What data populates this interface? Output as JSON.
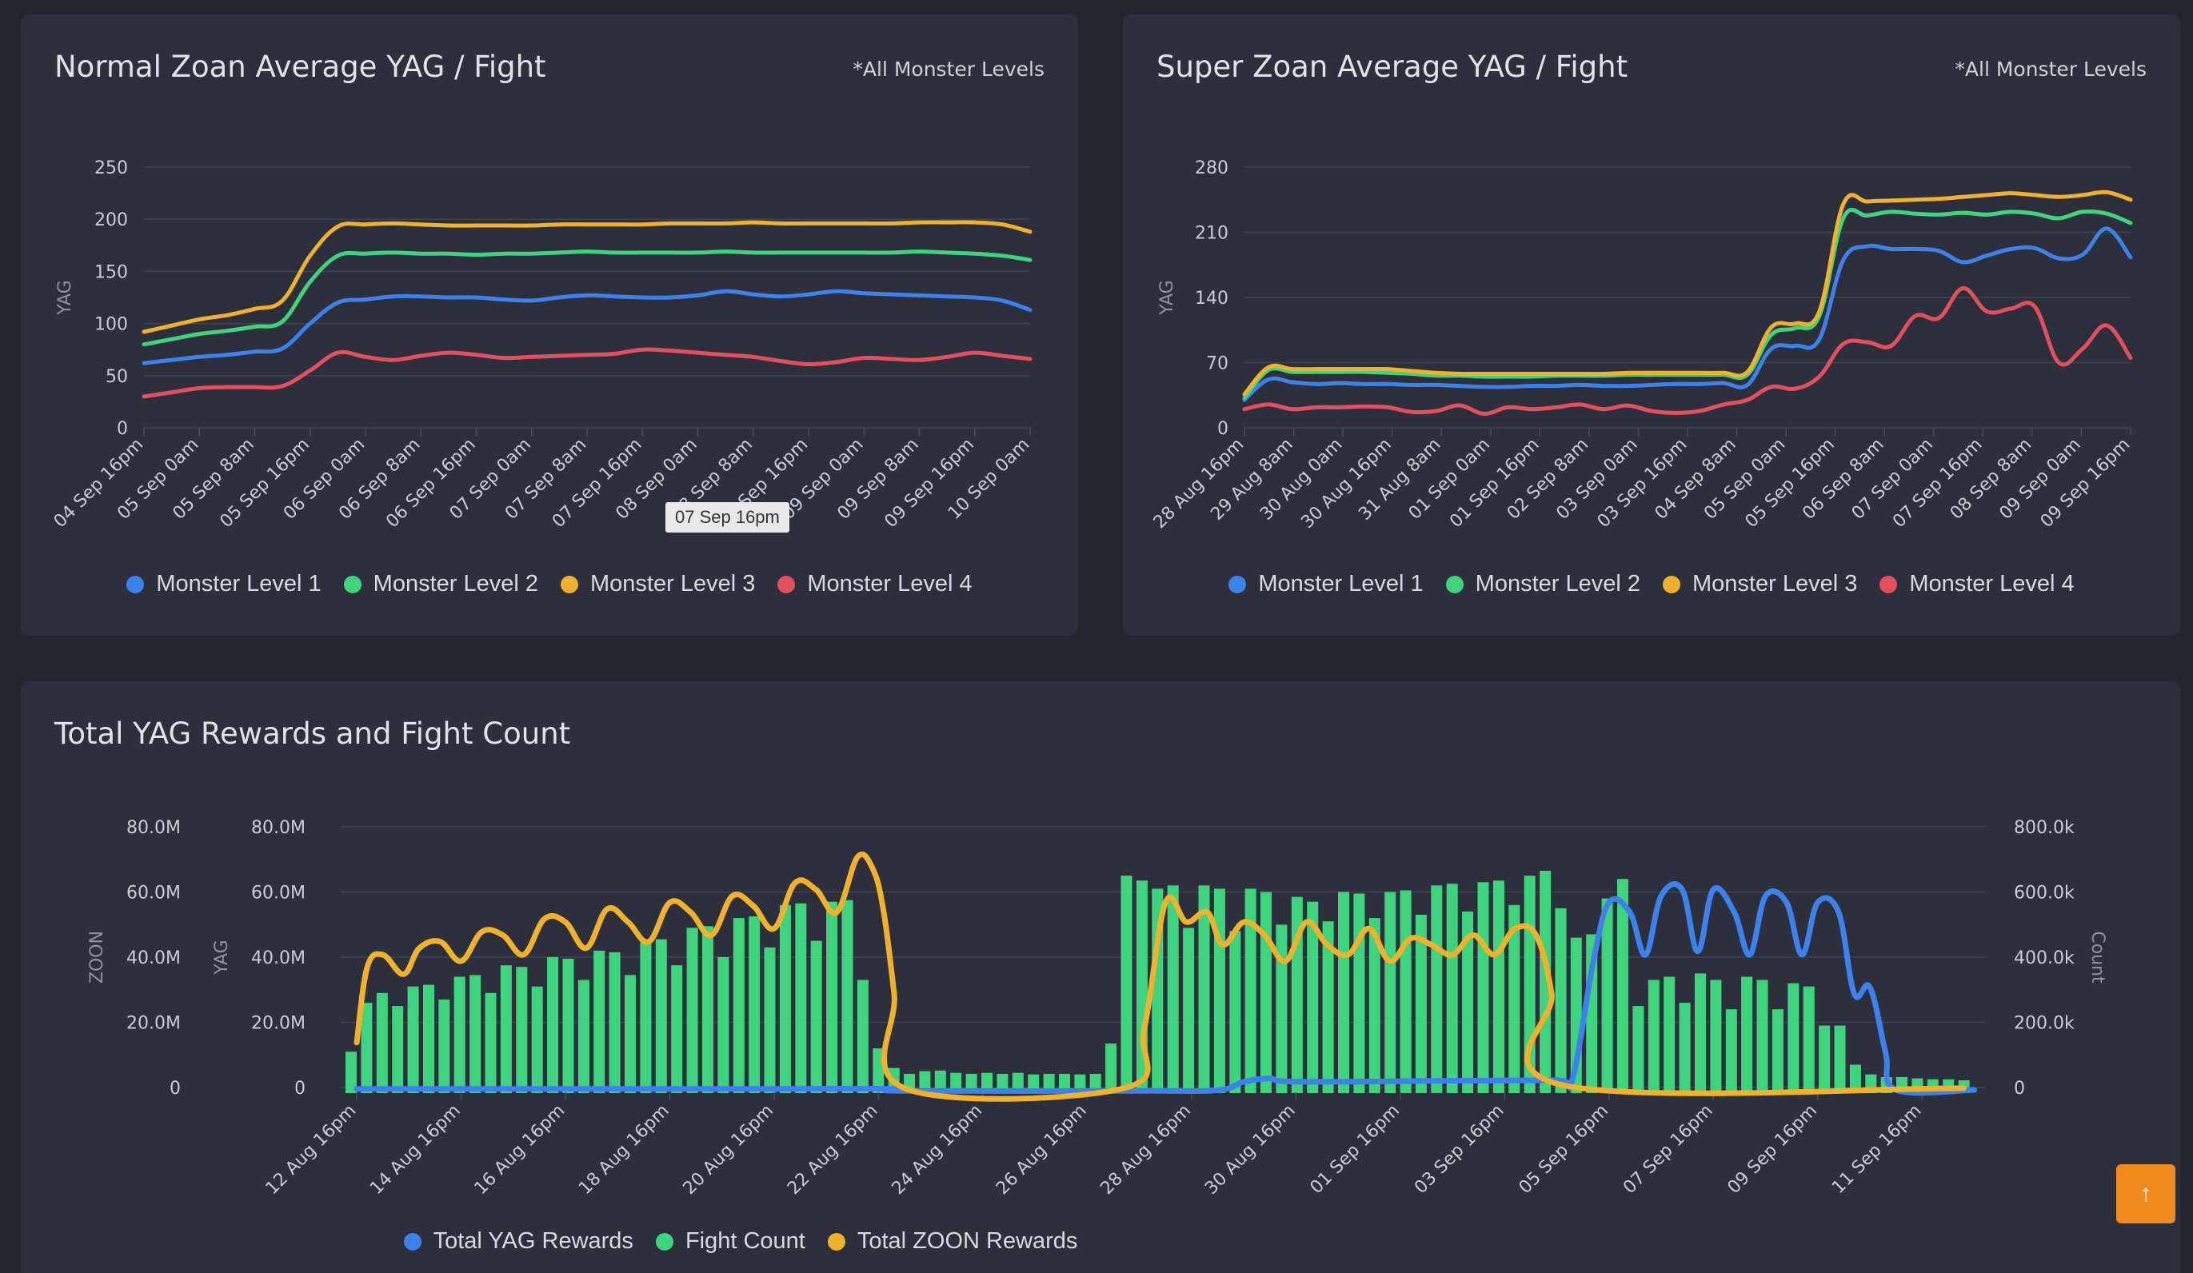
{
  "normal_card": {
    "title": "Normal Zoan Average YAG / Fight",
    "note": "*All Monster Levels",
    "tooltip": "07 Sep 16pm"
  },
  "super_card": {
    "title": "Super Zoan Average YAG / Fight",
    "note": "*All Monster Levels"
  },
  "total_card": {
    "title": "Total YAG Rewards and Fight Count"
  },
  "scroll_top": {
    "icon": "arrow-up-icon",
    "glyph": "↑"
  },
  "chart_data": [
    {
      "id": "normal",
      "type": "line",
      "ylabel": "YAG",
      "ylim": [
        0,
        250
      ],
      "yticks": [
        0,
        50,
        100,
        150,
        200,
        250
      ],
      "xticks": [
        "04 Sep 16pm",
        "05 Sep 0am",
        "05 Sep 8am",
        "05 Sep 16pm",
        "06 Sep 0am",
        "06 Sep 8am",
        "06 Sep 16pm",
        "07 Sep 0am",
        "07 Sep 8am",
        "07 Sep 16pm",
        "08 Sep 0am",
        "08 Sep 8am",
        "08 Sep 16pm",
        "09 Sep 0am",
        "09 Sep 8am",
        "09 Sep 16pm",
        "10 Sep 0am"
      ],
      "x": [
        0,
        0.5,
        1,
        1.5,
        2,
        2.5,
        3,
        3.5,
        4,
        4.5,
        5,
        5.5,
        6,
        6.5,
        7,
        7.5,
        8,
        8.5,
        9,
        9.5,
        10,
        10.5,
        11,
        11.5,
        12,
        12.5,
        13,
        13.5,
        14,
        14.5,
        15,
        15.5,
        16
      ],
      "grid": true,
      "legend_position": "bottom",
      "series": [
        {
          "name": "Monster Level 1",
          "color": "#3d82ec",
          "values": [
            62,
            65,
            68,
            70,
            73,
            76,
            100,
            120,
            123,
            126,
            126,
            125,
            125,
            123,
            122,
            125,
            127,
            126,
            125,
            125,
            127,
            131,
            128,
            126,
            128,
            131,
            129,
            128,
            127,
            126,
            125,
            122,
            113
          ]
        },
        {
          "name": "Monster Level 2",
          "color": "#3ed47e",
          "values": [
            80,
            85,
            90,
            93,
            97,
            102,
            140,
            165,
            167,
            168,
            167,
            167,
            166,
            167,
            167,
            168,
            169,
            168,
            168,
            168,
            168,
            169,
            168,
            168,
            168,
            168,
            168,
            168,
            169,
            168,
            167,
            165,
            161
          ]
        },
        {
          "name": "Monster Level 3",
          "color": "#f0b22b",
          "values": [
            92,
            98,
            104,
            108,
            114,
            122,
            165,
            193,
            195,
            196,
            195,
            194,
            194,
            194,
            194,
            195,
            195,
            195,
            195,
            196,
            196,
            196,
            197,
            196,
            196,
            196,
            196,
            196,
            197,
            197,
            197,
            195,
            188
          ]
        },
        {
          "name": "Monster Level 4",
          "color": "#e34f5f",
          "values": [
            30,
            34,
            38,
            39,
            39,
            40,
            55,
            72,
            68,
            65,
            69,
            72,
            70,
            67,
            68,
            69,
            70,
            71,
            75,
            74,
            72,
            70,
            68,
            64,
            61,
            63,
            67,
            66,
            65,
            68,
            72,
            69,
            66
          ]
        }
      ]
    },
    {
      "id": "super",
      "type": "line",
      "ylabel": "YAG",
      "ylim": [
        0,
        280
      ],
      "yticks": [
        0,
        70,
        140,
        210,
        280
      ],
      "xticks": [
        "28 Aug 16pm",
        "29 Aug 8am",
        "30 Aug 0am",
        "30 Aug 16pm",
        "31 Aug 8am",
        "01 Sep 0am",
        "01 Sep 16pm",
        "02 Sep 8am",
        "03 Sep 0am",
        "03 Sep 16pm",
        "04 Sep 8am",
        "05 Sep 0am",
        "05 Sep 16pm",
        "06 Sep 8am",
        "07 Sep 0am",
        "07 Sep 16pm",
        "08 Sep 8am",
        "09 Sep 0am",
        "09 Sep 16pm"
      ],
      "x": [
        0,
        0.5,
        1,
        1.5,
        2,
        2.5,
        3,
        3.5,
        4,
        4.5,
        5,
        5.5,
        6,
        6.5,
        7,
        7.5,
        8,
        8.5,
        9,
        9.5,
        10,
        10.5,
        11,
        11.5,
        12,
        12.5,
        13,
        13.5,
        14,
        14.5,
        15,
        15.5,
        16,
        16.5,
        17,
        17.5,
        18,
        18.5
      ],
      "grid": true,
      "legend_position": "bottom",
      "series": [
        {
          "name": "Monster Level 1",
          "color": "#3d82ec",
          "values": [
            30,
            52,
            49,
            47,
            48,
            47,
            47,
            46,
            46,
            45,
            44,
            44,
            45,
            45,
            46,
            45,
            45,
            46,
            47,
            47,
            48,
            46,
            85,
            88,
            95,
            180,
            195,
            192,
            192,
            190,
            178,
            185,
            192,
            193,
            182,
            186,
            214,
            183
          ]
        },
        {
          "name": "Monster Level 2",
          "color": "#3ed47e",
          "values": [
            32,
            62,
            60,
            60,
            60,
            60,
            59,
            58,
            56,
            56,
            55,
            55,
            55,
            56,
            56,
            56,
            57,
            57,
            57,
            57,
            57,
            57,
            100,
            107,
            120,
            225,
            228,
            232,
            230,
            229,
            231,
            229,
            232,
            230,
            225,
            232,
            230,
            220
          ]
        },
        {
          "name": "Monster Level 3",
          "color": "#f0b22b",
          "values": [
            36,
            65,
            63,
            63,
            63,
            63,
            63,
            61,
            59,
            58,
            58,
            58,
            58,
            58,
            58,
            58,
            59,
            59,
            59,
            59,
            59,
            60,
            108,
            112,
            125,
            240,
            243,
            244,
            245,
            246,
            248,
            250,
            252,
            250,
            248,
            250,
            253,
            245
          ]
        },
        {
          "name": "Monster Level 4",
          "color": "#e34f5f",
          "values": [
            20,
            25,
            20,
            22,
            22,
            23,
            22,
            17,
            18,
            24,
            15,
            22,
            20,
            22,
            25,
            20,
            24,
            18,
            16,
            18,
            25,
            30,
            44,
            42,
            55,
            90,
            92,
            88,
            120,
            118,
            150,
            125,
            128,
            130,
            70,
            85,
            110,
            75
          ]
        }
      ]
    },
    {
      "id": "total",
      "type": "bar+line",
      "ylabels": {
        "zoon": "ZOON",
        "yag": "YAG",
        "count": "Count"
      },
      "zoon_ticks": [
        "0",
        "20.0M",
        "40.0M",
        "60.0M",
        "80.0M"
      ],
      "yag_ticks": [
        "0",
        "20.0M",
        "40.0M",
        "60.0M",
        "80.0M"
      ],
      "count_ticks": [
        "0",
        "200.0k",
        "400.0k",
        "600.0k",
        "800.0k"
      ],
      "ylim_yag": [
        0,
        80000000
      ],
      "ylim_zoon": [
        0,
        80000000
      ],
      "ylim_count": [
        0,
        800000
      ],
      "xticks": [
        "12 Aug 16pm",
        "14 Aug 16pm",
        "16 Aug 16pm",
        "18 Aug 16pm",
        "20 Aug 16pm",
        "22 Aug 16pm",
        "24 Aug 16pm",
        "26 Aug 16pm",
        "28 Aug 16pm",
        "30 Aug 16pm",
        "01 Sep 16pm",
        "03 Sep 16pm",
        "05 Sep 16pm",
        "07 Sep 16pm",
        "09 Sep 16pm",
        "11 Sep 16pm"
      ],
      "x_days": [
        0,
        2,
        4,
        6,
        8,
        10,
        12,
        14,
        16,
        18,
        20,
        22,
        24,
        26,
        28,
        30
      ],
      "grid": true,
      "legend_position": "bottom",
      "series": [
        {
          "name": "Total YAG Rewards",
          "color": "#3d82ec",
          "axis": "yag",
          "points": [
            [
              0,
              0.8
            ],
            [
              8,
              0.8
            ],
            [
              10.3,
              0.8
            ],
            [
              10.45,
              0.2
            ],
            [
              15,
              0.2
            ],
            [
              16.5,
              0.4
            ],
            [
              17,
              3
            ],
            [
              17.5,
              4
            ],
            [
              18,
              3
            ],
            [
              21,
              3.3
            ],
            [
              23,
              3.5
            ],
            [
              23.3,
              4
            ],
            [
              23.7,
              40
            ],
            [
              24,
              58
            ],
            [
              24.4,
              55
            ],
            [
              24.7,
              42
            ],
            [
              25,
              60
            ],
            [
              25.4,
              62
            ],
            [
              25.7,
              43
            ],
            [
              26,
              62
            ],
            [
              26.4,
              55
            ],
            [
              26.7,
              42
            ],
            [
              27,
              60
            ],
            [
              27.4,
              58
            ],
            [
              27.7,
              42
            ],
            [
              28,
              58
            ],
            [
              28.4,
              55
            ],
            [
              28.7,
              30
            ],
            [
              29,
              32
            ],
            [
              29.3,
              12
            ],
            [
              29.5,
              0.5
            ],
            [
              31,
              0.5
            ]
          ]
        },
        {
          "name": "Fight Count",
          "color": "#3ed47e",
          "axis": "count",
          "type": "bar",
          "values": [
            110,
            260,
            290,
            250,
            310,
            315,
            270,
            340,
            345,
            290,
            375,
            370,
            310,
            400,
            395,
            330,
            420,
            415,
            345,
            450,
            455,
            375,
            490,
            495,
            400,
            520,
            525,
            430,
            560,
            565,
            450,
            570,
            575,
            330,
            120,
            60,
            42,
            50,
            52,
            45,
            42,
            45,
            42,
            45,
            40,
            42,
            42,
            40,
            42,
            135,
            650,
            635,
            610,
            620,
            490,
            620,
            610,
            480,
            610,
            600,
            500,
            585,
            570,
            510,
            600,
            595,
            520,
            600,
            605,
            530,
            620,
            625,
            540,
            630,
            635,
            560,
            650,
            665,
            550,
            460,
            470,
            580,
            640,
            250,
            330,
            340,
            260,
            350,
            330,
            240,
            340,
            330,
            240,
            320,
            310,
            190,
            190,
            70,
            40,
            32,
            32,
            28,
            25,
            25,
            22
          ]
        },
        {
          "name": "Total ZOON Rewards",
          "color": "#f0b22b",
          "axis": "zoon",
          "points": [
            [
              0,
              15
            ],
            [
              0.2,
              38
            ],
            [
              0.5,
              42
            ],
            [
              0.9,
              36
            ],
            [
              1.2,
              44
            ],
            [
              1.6,
              46
            ],
            [
              2,
              40
            ],
            [
              2.4,
              49
            ],
            [
              2.8,
              48
            ],
            [
              3.2,
              42
            ],
            [
              3.6,
              53
            ],
            [
              4,
              52
            ],
            [
              4.4,
              44
            ],
            [
              4.8,
              56
            ],
            [
              5.2,
              52
            ],
            [
              5.6,
              46
            ],
            [
              6,
              58
            ],
            [
              6.4,
              55
            ],
            [
              6.8,
              48
            ],
            [
              7.2,
              60
            ],
            [
              7.6,
              57
            ],
            [
              8,
              50
            ],
            [
              8.4,
              64
            ],
            [
              8.8,
              62
            ],
            [
              9.2,
              55
            ],
            [
              9.6,
              72
            ],
            [
              9.9,
              68
            ],
            [
              10.1,
              55
            ],
            [
              10.3,
              30
            ],
            [
              10.5,
              1
            ],
            [
              14.7,
              1
            ],
            [
              15.1,
              20
            ],
            [
              15.5,
              58
            ],
            [
              15.9,
              52
            ],
            [
              16.3,
              55
            ],
            [
              16.6,
              45
            ],
            [
              17,
              52
            ],
            [
              17.4,
              48
            ],
            [
              17.8,
              40
            ],
            [
              18.2,
              52
            ],
            [
              18.6,
              45
            ],
            [
              19,
              42
            ],
            [
              19.4,
              50
            ],
            [
              19.8,
              40
            ],
            [
              20.2,
              47
            ],
            [
              20.6,
              45
            ],
            [
              21,
              42
            ],
            [
              21.4,
              48
            ],
            [
              21.8,
              42
            ],
            [
              22.2,
              50
            ],
            [
              22.6,
              48
            ],
            [
              22.9,
              30
            ],
            [
              23.1,
              2
            ],
            [
              30.8,
              1
            ]
          ]
        }
      ]
    }
  ],
  "legend_normal": [
    "Monster Level 1",
    "Monster Level 2",
    "Monster Level 3",
    "Monster Level 4"
  ],
  "legend_super": [
    "Monster Level 1",
    "Monster Level 2",
    "Monster Level 3",
    "Monster Level 4"
  ],
  "legend_total": [
    "Total YAG Rewards",
    "Fight Count",
    "Total ZOON Rewards"
  ]
}
